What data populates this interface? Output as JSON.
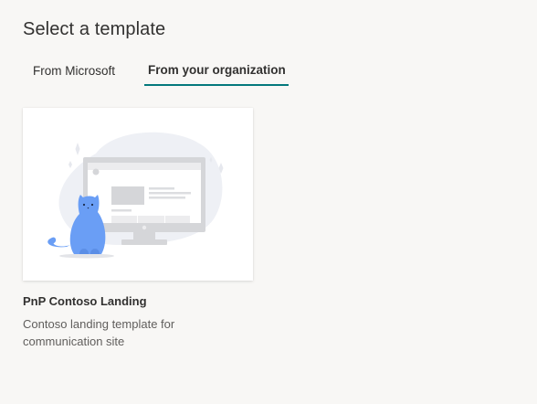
{
  "header": {
    "title": "Select a template"
  },
  "tabs": [
    {
      "label": "From Microsoft",
      "selected": false
    },
    {
      "label": "From your organization",
      "selected": true
    }
  ],
  "templates": [
    {
      "name": "PnP Contoso Landing",
      "description": "Contoso landing template for communication site",
      "thumbnail_icon": "cat-with-monitor-illustration"
    }
  ],
  "colors": {
    "accent": "#03787c",
    "background": "#f8f7f5",
    "card": "#ffffff",
    "cat": "#6a9ef5"
  }
}
